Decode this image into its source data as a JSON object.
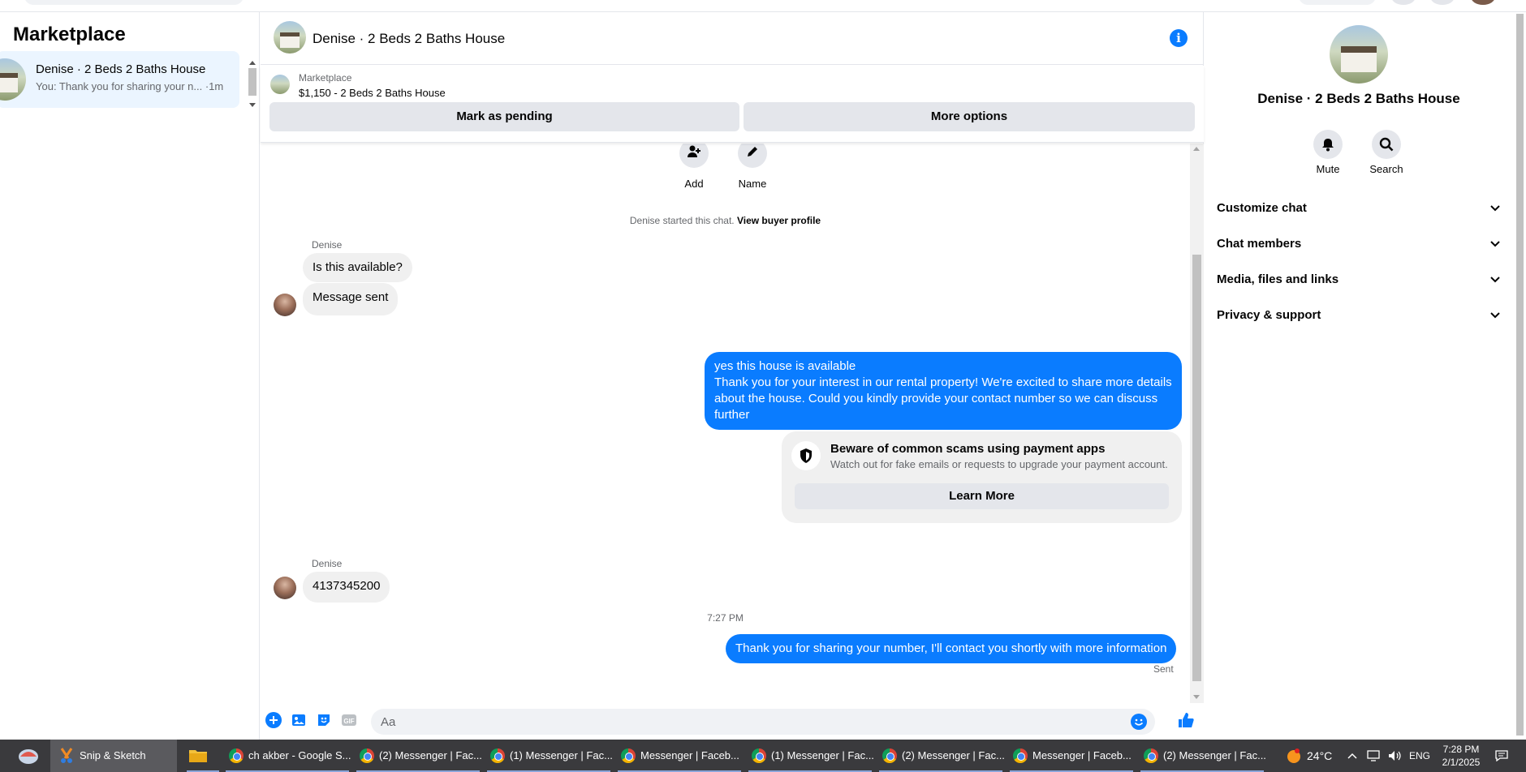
{
  "left": {
    "title": "Marketplace",
    "conversation": {
      "name": "Denise · 2 Beds 2 Baths House",
      "preview": "You: Thank you for sharing your n... ·1m"
    }
  },
  "header": {
    "title": "Denise · 2 Beds 2 Baths House"
  },
  "listing": {
    "label": "Marketplace",
    "price_title": "$1,150 - 2 Beds 2 Baths House",
    "mark_pending": "Mark as pending",
    "more_options": "More options"
  },
  "quick_actions": {
    "add": "Add",
    "name": "Name"
  },
  "chat": {
    "started_text": "Denise started this chat.",
    "view_profile": "View buyer profile",
    "sender1": "Denise",
    "msg1": "Is this available?",
    "msg2": "Message sent",
    "out1_line1": "yes this house is available",
    "out1_body": "Thank you for your interest in our rental property! We're excited to share more details about the house. Could you kindly provide your contact number so we can discuss further",
    "warning_title": "Beware of common scams using payment apps",
    "warning_sub": "Watch out for fake emails or requests to upgrade your payment account.",
    "learn_more": "Learn More",
    "sender2": "Denise",
    "msg3": "4137345200",
    "timestamp": "7:27 PM",
    "out2": "Thank you for sharing your number, I'll contact you shortly with more information",
    "status": "Sent"
  },
  "composer": {
    "placeholder": "Aa"
  },
  "right": {
    "name": "Denise · 2 Beds 2 Baths House",
    "mute": "Mute",
    "search": "Search",
    "sections": [
      "Customize chat",
      "Chat members",
      "Media, files and links",
      "Privacy & support"
    ]
  },
  "taskbar": {
    "items": [
      "Snip & Sketch",
      "ch akber - Google S...",
      "(2) Messenger | Fac...",
      "(1) Messenger | Fac...",
      "Messenger | Faceb...",
      "(1) Messenger | Fac...",
      "(2) Messenger | Fac...",
      "Messenger | Faceb...",
      "(2) Messenger | Fac..."
    ],
    "weather": "24°C",
    "language": "ENG",
    "time": "7:28 PM",
    "date": "2/1/2025"
  },
  "colors": {
    "accent": "#0a7cff",
    "bubble_in": "#f0f0f0",
    "selected_bg": "#ebf5ff",
    "taskbar": "#3a3a3d"
  }
}
